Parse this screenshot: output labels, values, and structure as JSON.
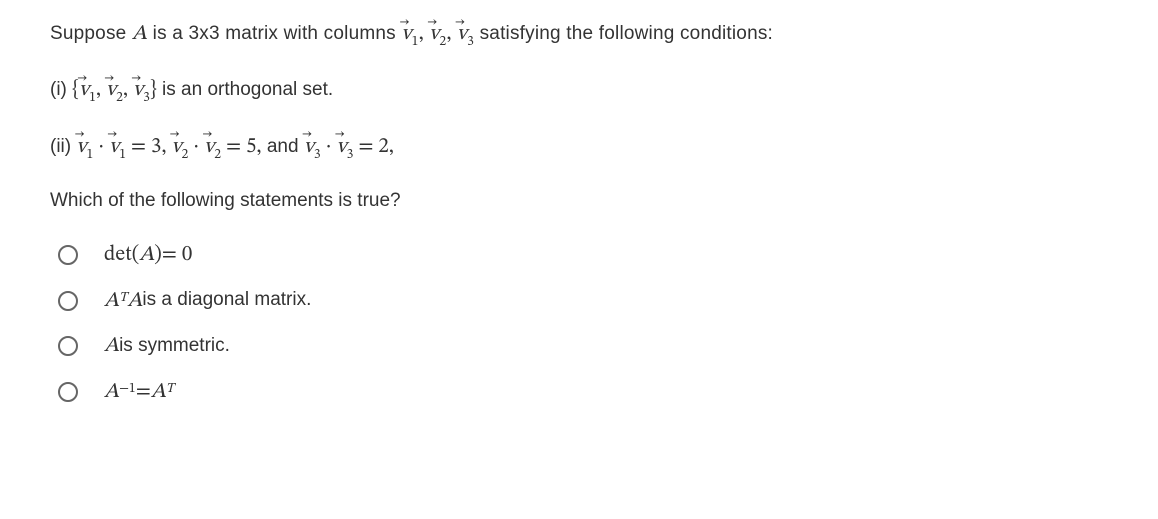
{
  "stem": {
    "pre": "Suppose ",
    "A": "A",
    "mid1": " is a 3x3 matrix with columns ",
    "v1": "v",
    "s1": "1",
    "comma1": ", ",
    "v2": "v",
    "s2": "2",
    "comma2": ", ",
    "v3": "v",
    "s3": "3",
    "post": "  satisfying the following conditions:"
  },
  "cond1": {
    "label": "(i) ",
    "lb": "{",
    "v1": "v",
    "s1": "1",
    "comma1": ", ",
    "v2": "v",
    "s2": "2",
    "comma2": ", ",
    "v3": "v",
    "s3": "3",
    "rb": "}",
    "post": "  is an orthogonal set."
  },
  "cond2": {
    "label": "(ii) ",
    "v1a": "v",
    "s1a": "1",
    "dot1": " · ",
    "v1b": "v",
    "s1b": "1",
    "eq1": " = 3,  ",
    "v2a": "v",
    "s2a": "2",
    "dot2": " · ",
    "v2b": "v",
    "s2b": "2",
    "eq2": " = 5,",
    "and": "  and  ",
    "v3a": "v",
    "s3a": "3",
    "dot3": " · ",
    "v3b": "v",
    "s3b": "3",
    "eq3": " = 2,"
  },
  "prompt": "Which of the following statements is true?",
  "options": {
    "a": {
      "det": "det",
      "lp": "(",
      "A": "A",
      "rp": ")",
      "eq": " = 0"
    },
    "b": {
      "A1": "A",
      "T": "T",
      "A2": "A",
      "post": " is a diagonal matrix."
    },
    "c": {
      "A": "A",
      "post": " is symmetric."
    },
    "d": {
      "A1": "A",
      "neg1": "−1",
      "eq": " = ",
      "A2": "A",
      "T": "T"
    }
  }
}
